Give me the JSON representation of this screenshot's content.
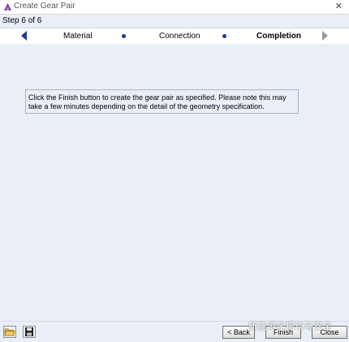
{
  "window": {
    "title": "Create Gear Pair",
    "close_glyph": "✕"
  },
  "step_indicator": "Step 6 of 6",
  "wizard_tabs": [
    {
      "label": "Material"
    },
    {
      "label": "Connection"
    },
    {
      "label": "Completion"
    }
  ],
  "message": "Click the Finish button to create the gear pair as specified. Please note this may take a few minutes depending on the detail of the geometry specification.",
  "buttons": {
    "back": "< Back",
    "finish": "Finish",
    "close": "Close"
  },
  "icons": {
    "app": "app-logo-icon",
    "open": "open-folder-icon",
    "save": "save-disk-icon",
    "nav_prev": "arrow-left-icon",
    "nav_next": "arrow-right-icon"
  },
  "watermark": "新能源车振动与安全",
  "colors": {
    "panel": "#eaeff7",
    "nav_active": "#1f3a8c",
    "nav_disabled": "#9a9a9a"
  }
}
